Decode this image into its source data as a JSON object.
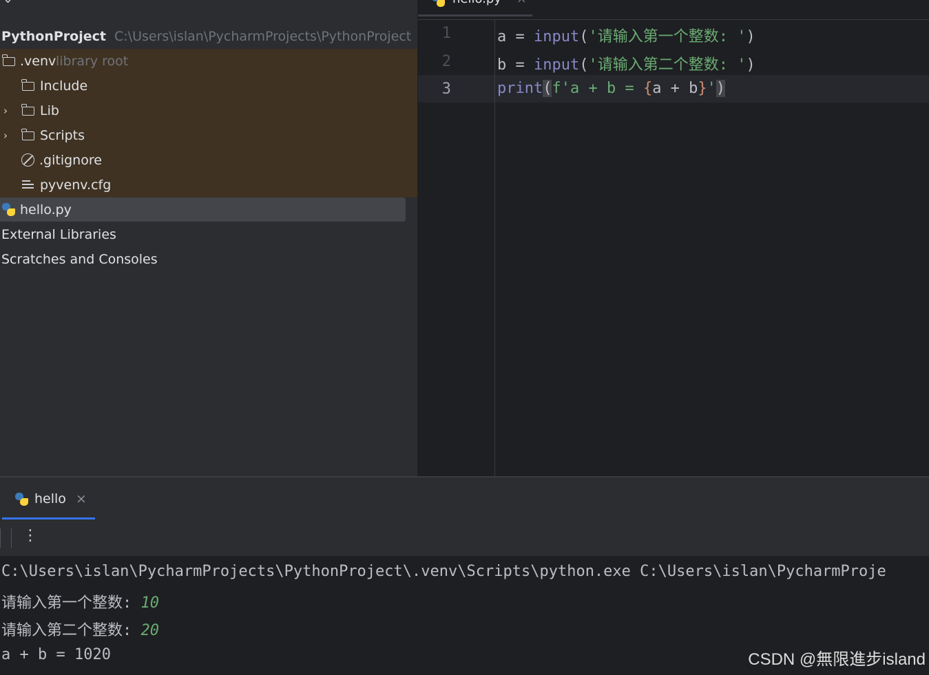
{
  "project_tree": {
    "top_glyph": "⌄",
    "root": {
      "name": "PythonProject",
      "path": "C:\\Users\\islan\\PycharmProjects\\PythonProject"
    },
    "venv": {
      "name": ".venv",
      "hint": "library root"
    },
    "items": [
      {
        "label": "Include",
        "icon": "folder-icon"
      },
      {
        "label": "Lib",
        "icon": "folder-icon"
      },
      {
        "label": "Scripts",
        "icon": "folder-icon"
      },
      {
        "label": ".gitignore",
        "icon": "ignore-file-icon"
      },
      {
        "label": "pyvenv.cfg",
        "icon": "text-file-icon"
      }
    ],
    "selected_file": "hello.py",
    "external_libraries": "External Libraries",
    "scratches": "Scratches and Consoles"
  },
  "editor": {
    "tab_label": "hello.py",
    "tab_close": "×",
    "line_numbers": [
      "1",
      "2",
      "3"
    ],
    "current_line": 3,
    "lines": [
      {
        "var": "a",
        "op": " = ",
        "func": "input",
        "open": "(",
        "string": "'请输入第一个整数: '",
        "close": ")"
      },
      {
        "var": "b",
        "op": " = ",
        "func": "input",
        "open": "(",
        "string": "'请输入第二个整数: '",
        "close": ")"
      },
      {
        "func": "print",
        "open": "(",
        "fprefix": "f'a + b = ",
        "brace_open": "{",
        "expr": "a + b",
        "brace_close": "}",
        "fsuffix": "'",
        "close": ")"
      }
    ]
  },
  "run_panel": {
    "tab_label": "hello",
    "tab_close": "×",
    "more_menu": "⋮",
    "output": [
      {
        "text": "C:\\Users\\islan\\PycharmProjects\\PythonProject\\.venv\\Scripts\\python.exe C:\\Users\\islan\\PycharmProje"
      },
      {
        "prompt": "请输入第一个整数: ",
        "input": "10"
      },
      {
        "prompt": "请输入第二个整数: ",
        "input": "20"
      },
      {
        "text": "a + b = 1020"
      }
    ]
  },
  "watermark": "CSDN @無限進步island",
  "colors": {
    "keyword": "#8888c6",
    "string": "#6aab73",
    "brace": "#cf8e6d",
    "accent": "#3574f0",
    "venv_bg": "#3f3222"
  }
}
